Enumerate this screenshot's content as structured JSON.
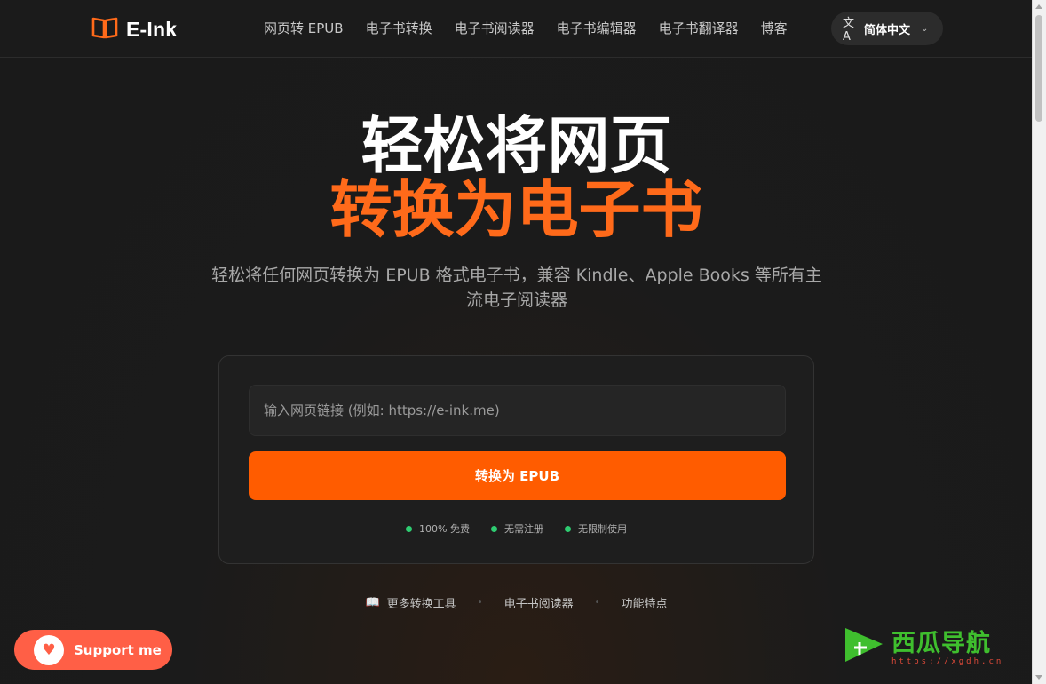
{
  "header": {
    "logo_text": "E-Ink",
    "nav": [
      "网页转 EPUB",
      "电子书转换",
      "电子书阅读器",
      "电子书编辑器",
      "电子书翻译器",
      "博客"
    ],
    "language": "简体中文"
  },
  "hero": {
    "line1": "轻松将网页",
    "line2": "转换为电子书",
    "subtitle": "轻松将任何网页转换为 EPUB 格式电子书，兼容 Kindle、Apple Books 等所有主流电子阅读器"
  },
  "converter": {
    "input_placeholder": "输入网页链接 (例如: https://e-ink.me)",
    "input_value": "",
    "button_label": "转换为 EPUB",
    "features": [
      "100% 免费",
      "无需注册",
      "无限制使用"
    ]
  },
  "links": [
    "更多转换工具",
    "电子书阅读器",
    "功能特点"
  ],
  "support": {
    "label": "Support me"
  },
  "watermark": {
    "name": "西瓜导航",
    "url": "https://xgdh.cn"
  },
  "colors": {
    "accent": "#ff5c00",
    "accent_light": "#ff6a1a",
    "feature_dot": "#2ecc71",
    "support_bg": "#ff5f46",
    "background": "#1a1a1a"
  }
}
